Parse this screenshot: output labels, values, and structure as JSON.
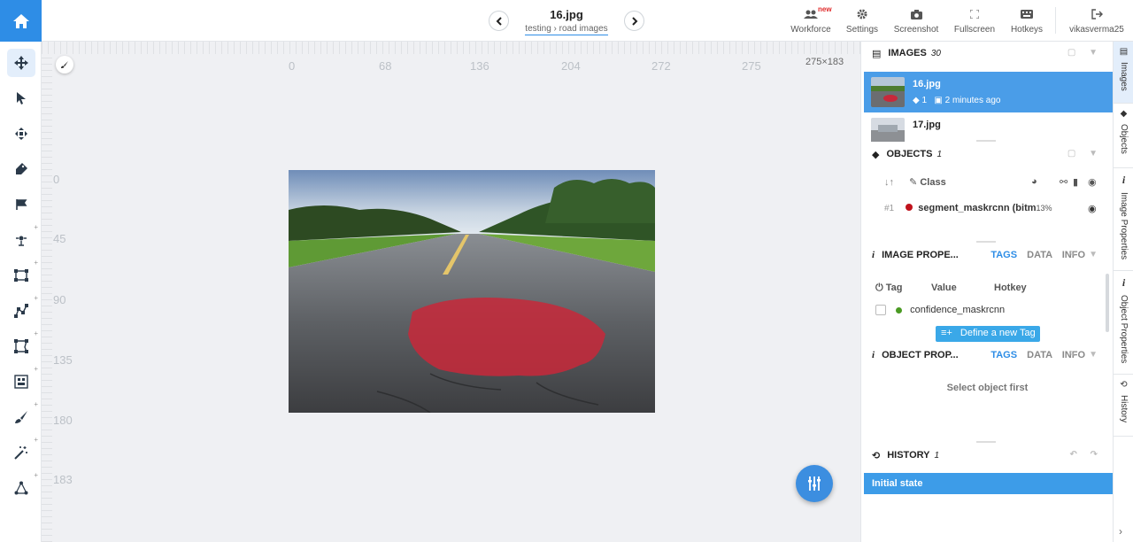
{
  "topbar": {
    "file_name": "16.jpg",
    "crumb": "testing › road images",
    "new_badge": "new",
    "actions": {
      "workforce": "Workforce",
      "settings": "Settings",
      "screenshot": "Screenshot",
      "fullscreen": "Fullscreen",
      "hotkeys": "Hotkeys",
      "user": "vikasverma25"
    }
  },
  "canvas": {
    "ruler_x": [
      "0",
      "68",
      "136",
      "204",
      "272",
      "275"
    ],
    "ruler_y": [
      "0",
      "45",
      "90",
      "135",
      "180",
      "183"
    ],
    "dimensions": "275×183"
  },
  "images": {
    "title": "IMAGES",
    "count": "30",
    "items": [
      {
        "name": "16.jpg",
        "objects": "1",
        "time": "2 minutes ago",
        "selected": true
      },
      {
        "name": "17.jpg"
      }
    ]
  },
  "objects": {
    "title": "OBJECTS",
    "count": "1",
    "col_class": "Class",
    "rows": [
      {
        "index": "#1",
        "name": "segment_maskrcnn (bitm",
        "percent": "13%",
        "color": "#c0121c"
      }
    ]
  },
  "image_properties": {
    "title": "IMAGE PROPE...",
    "tabs": [
      "TAGS",
      "DATA",
      "INFO"
    ],
    "col_tag": "Tag",
    "col_value": "Value",
    "col_hotkey": "Hotkey",
    "tag_name": "confidence_maskrcnn",
    "tag_color": "#4a9a23",
    "define_button": "Define a new Tag"
  },
  "object_properties": {
    "title": "OBJECT PROP...",
    "tabs": [
      "TAGS",
      "DATA",
      "INFO"
    ],
    "empty": "Select object first"
  },
  "history": {
    "title": "HISTORY",
    "count": "1",
    "items": [
      "Initial state"
    ]
  },
  "side_tabs": [
    "Images",
    "Objects",
    "Image Properties",
    "Object Properties",
    "History"
  ],
  "colors": {
    "accent": "#2e8de6",
    "mask": "#c8283a"
  }
}
